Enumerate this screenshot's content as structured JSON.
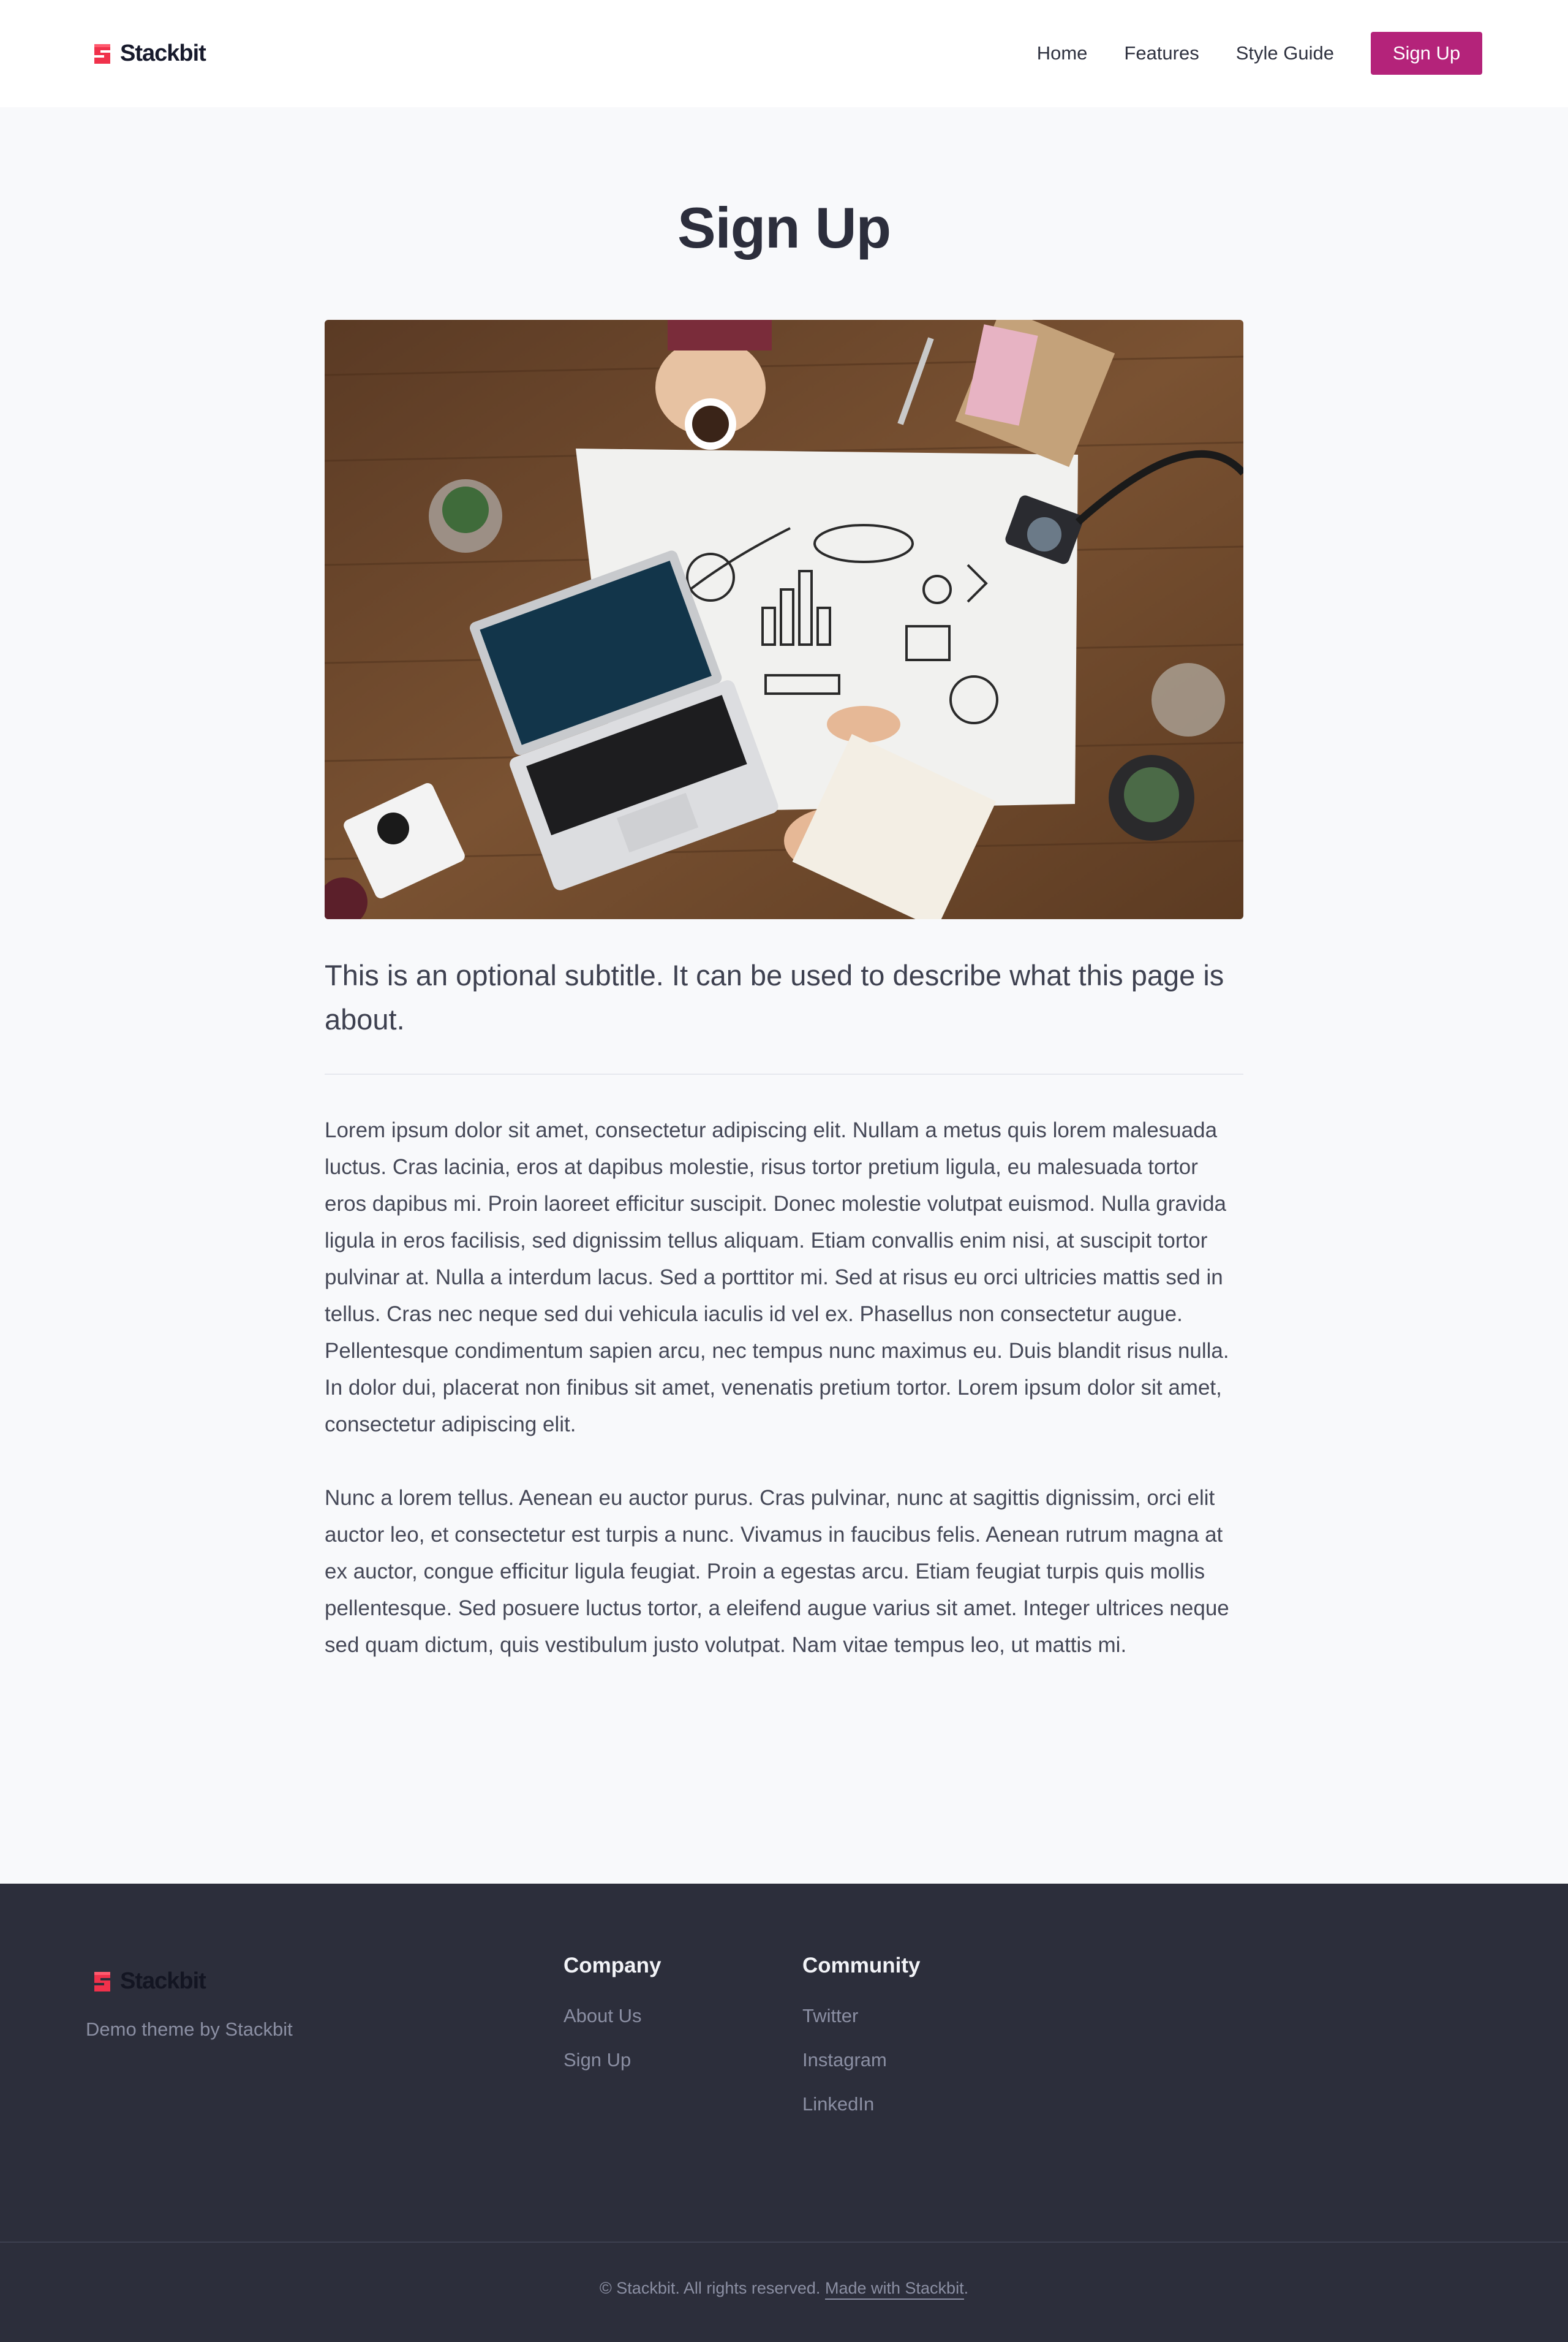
{
  "brand": {
    "name": "Stackbit",
    "accent": "#b4237a",
    "logo_color": "#f0314b"
  },
  "header": {
    "logo_label": "Stackbit",
    "nav": [
      {
        "label": "Home"
      },
      {
        "label": "Features"
      },
      {
        "label": "Style Guide"
      }
    ],
    "cta_label": "Sign Up"
  },
  "main": {
    "title": "Sign Up",
    "hero_image": "desk-workspace-photo",
    "subtitle": "This is an optional subtitle. It can be used to describe what this page is about.",
    "paragraphs": [
      "Lorem ipsum dolor sit amet, consectetur adipiscing elit. Nullam a metus quis lorem malesuada luctus. Cras lacinia, eros at dapibus molestie, risus tortor pretium ligula, eu malesuada tortor eros dapibus mi. Proin laoreet efficitur suscipit. Donec molestie volutpat euismod. Nulla gravida ligula in eros facilisis, sed dignissim tellus aliquam. Etiam convallis enim nisi, at suscipit tortor pulvinar at. Nulla a interdum lacus. Sed a porttitor mi. Sed at risus eu orci ultricies mattis sed in tellus. Cras nec neque sed dui vehicula iaculis id vel ex. Phasellus non consectetur augue. Pellentesque condimentum sapien arcu, nec tempus nunc maximus eu. Duis blandit risus nulla. In dolor dui, placerat non finibus sit amet, venenatis pretium tortor. Lorem ipsum dolor sit amet, consectetur adipiscing elit.",
      "Nunc a lorem tellus. Aenean eu auctor purus. Cras pulvinar, nunc at sagittis dignissim, orci elit auctor leo, et consectetur est turpis a nunc. Vivamus in faucibus felis. Aenean rutrum magna at ex auctor, congue efficitur ligula feugiat. Proin a egestas arcu. Etiam feugiat turpis quis mollis pellentesque. Sed posuere luctus tortor, a eleifend augue varius sit amet. Integer ultrices neque sed quam dictum, quis vestibulum justo volutpat. Nam vitae tempus leo, ut mattis mi."
    ]
  },
  "footer": {
    "logo_label": "Stackbit",
    "tagline": "Demo theme by Stackbit",
    "columns": [
      {
        "heading": "Company",
        "links": [
          {
            "label": "About Us"
          },
          {
            "label": "Sign Up"
          }
        ]
      },
      {
        "heading": "Community",
        "links": [
          {
            "label": "Twitter"
          },
          {
            "label": "Instagram"
          },
          {
            "label": "LinkedIn"
          }
        ]
      }
    ],
    "copyright": "© Stackbit. All rights reserved.",
    "made_with": "Made with Stackbit",
    "made_with_suffix": "."
  }
}
